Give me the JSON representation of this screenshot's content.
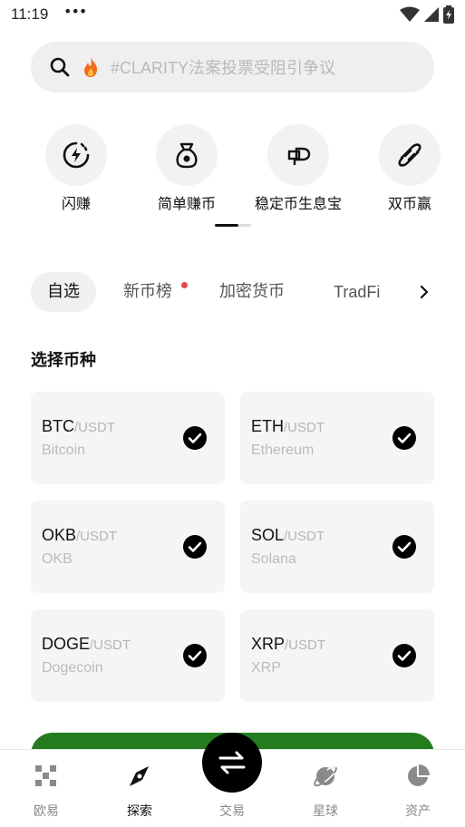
{
  "status_bar": {
    "time": "11:19",
    "dots": "•••"
  },
  "search": {
    "placeholder": "#CLARITY法案投票受阻引争议"
  },
  "quick_entries": [
    {
      "label": "闪赚",
      "icon": "flash-earn-icon"
    },
    {
      "label": "简单赚币",
      "icon": "money-bag-icon"
    },
    {
      "label": "稳定币生息宝",
      "icon": "stablecoin-icon"
    },
    {
      "label": "双币赢",
      "icon": "dual-coin-icon"
    }
  ],
  "tabs": [
    {
      "label": "自选",
      "active": true
    },
    {
      "label": "新币榜",
      "has_dot": true
    },
    {
      "label": "加密货币"
    },
    {
      "label": "TradFi"
    }
  ],
  "section_title": "选择币种",
  "coins": [
    {
      "symbol": "BTC",
      "quote": "/USDT",
      "name": "Bitcoin",
      "selected": true
    },
    {
      "symbol": "ETH",
      "quote": "/USDT",
      "name": "Ethereum",
      "selected": true
    },
    {
      "symbol": "OKB",
      "quote": "/USDT",
      "name": "OKB",
      "selected": true
    },
    {
      "symbol": "SOL",
      "quote": "/USDT",
      "name": "Solana",
      "selected": true
    },
    {
      "symbol": "DOGE",
      "quote": "/USDT",
      "name": "Dogecoin",
      "selected": true
    },
    {
      "symbol": "XRP",
      "quote": "/USDT",
      "name": "XRP",
      "selected": true
    }
  ],
  "bottom_nav": [
    {
      "label": "欧易",
      "icon": "okx-logo-icon"
    },
    {
      "label": "探索",
      "icon": "compass-icon",
      "active": true
    },
    {
      "label": "交易",
      "icon": "swap-icon"
    },
    {
      "label": "星球",
      "icon": "planet-icon"
    },
    {
      "label": "资产",
      "icon": "pie-chart-icon"
    }
  ],
  "colors": {
    "accent_green": "#247c1f",
    "notification_dot": "#e5484d"
  }
}
